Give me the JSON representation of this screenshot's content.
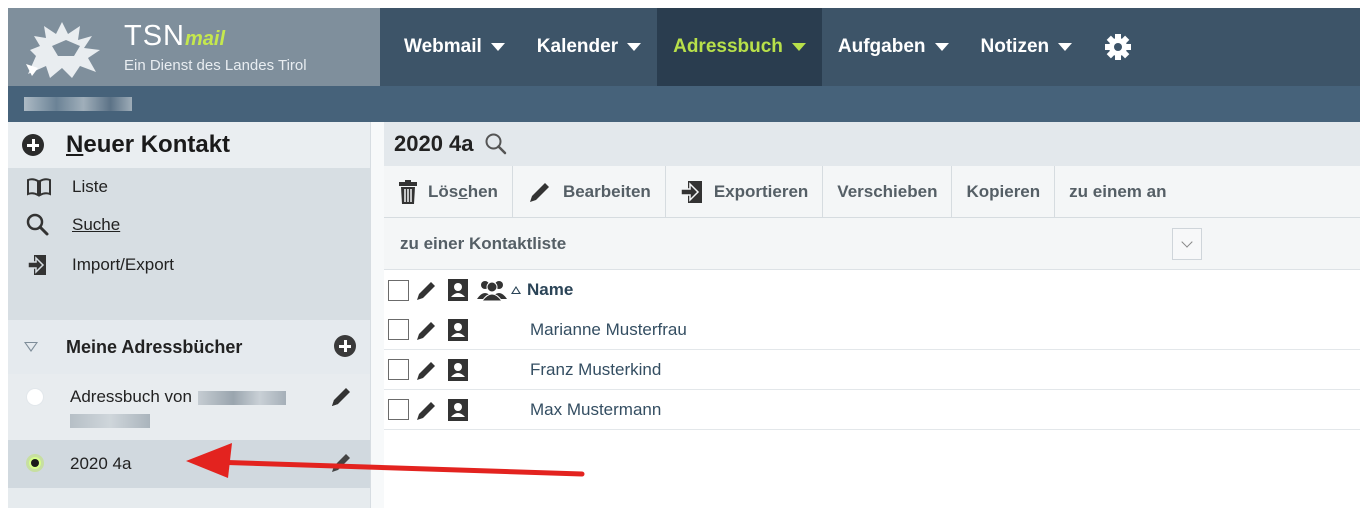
{
  "app": {
    "logo_brand": "TSN",
    "logo_brand_suffix": "mail",
    "logo_subtitle": "Ein Dienst des Landes Tirol",
    "accent_color": "#b8e04a",
    "header_color": "#3d5468"
  },
  "topnav": [
    {
      "label": "Webmail",
      "active": false
    },
    {
      "label": "Kalender",
      "active": false
    },
    {
      "label": "Adressbuch",
      "active": true
    },
    {
      "label": "Aufgaben",
      "active": false
    },
    {
      "label": "Notizen",
      "active": false
    }
  ],
  "sidebar": {
    "new_contact_mnemonic": "N",
    "new_contact_rest": "euer Kontakt",
    "menu": [
      {
        "label": "Liste",
        "icon": "book-icon"
      },
      {
        "label": "Suche",
        "icon": "search-icon"
      },
      {
        "label": "Import/Export",
        "icon": "import-export-icon"
      }
    ],
    "my_addressbooks": "Meine Adressbücher",
    "addressbooks": [
      {
        "label": "Adressbuch von",
        "selected": false
      },
      {
        "label": "2020 4a",
        "selected": true
      }
    ]
  },
  "main": {
    "title": "2020 4a",
    "toolbar": {
      "delete_pre": "Lös",
      "delete_mnemonic": "c",
      "delete_post": "hen",
      "edit": "Bearbeiten",
      "export": "Exportieren",
      "move": "Verschieben",
      "copy": "Kopieren",
      "add_to": "zu einem an"
    },
    "contactlist_select": "zu einer Kontaktliste",
    "column_name": "Name",
    "contacts": [
      {
        "name": "Marianne Musterfrau"
      },
      {
        "name": "Franz Musterkind"
      },
      {
        "name": "Max Mustermann"
      }
    ]
  }
}
